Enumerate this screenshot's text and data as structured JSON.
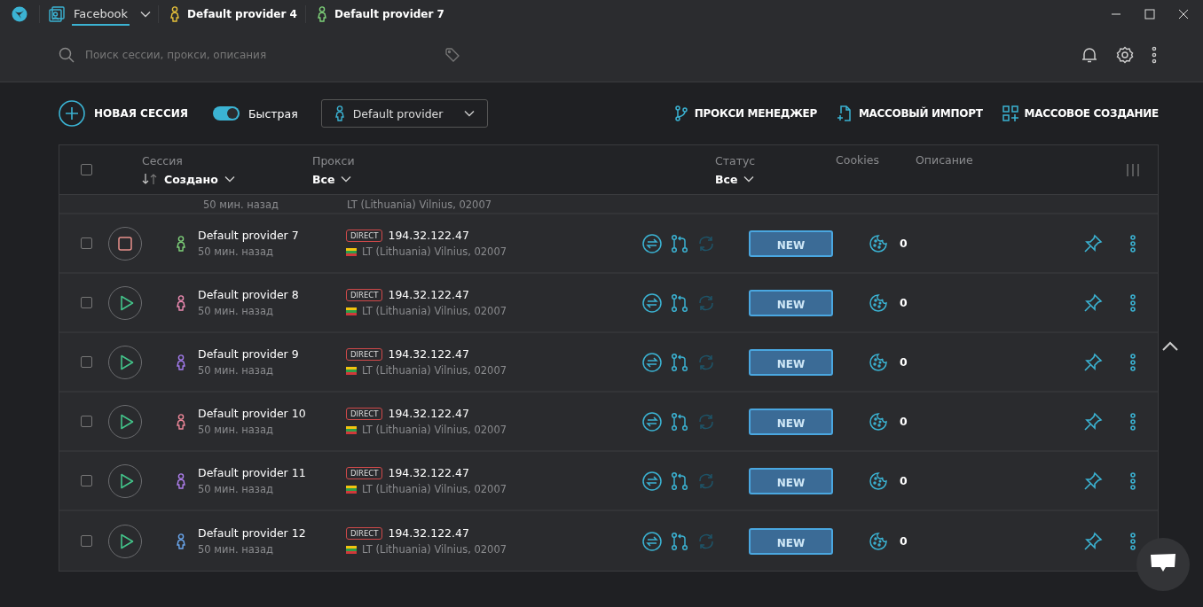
{
  "tabs": [
    {
      "label": "Facebook",
      "kind": "app",
      "selected": true
    },
    {
      "label": "Default provider 4",
      "kind": "profile",
      "color": "#e8c23a",
      "selected": false
    },
    {
      "label": "Default provider 7",
      "kind": "profile",
      "color": "#7fd37a",
      "selected": false
    }
  ],
  "search": {
    "placeholder": "Поиск сессии, прокси, описания"
  },
  "toolbar": {
    "new_session": "НОВАЯ СЕССИЯ",
    "quick": {
      "label": "Быстрая",
      "on": true
    },
    "provider": "Default provider",
    "actions": [
      "ПРОКСИ МЕНЕДЖЕР",
      "МАССОВЫЙ ИМПОРТ",
      "МАССОВОЕ СОЗДАНИЕ"
    ]
  },
  "table": {
    "select_all": {
      "checked": false
    },
    "columns": {
      "session": "Сессия",
      "sort": "Создано",
      "proxy": "Прокси",
      "proxy_filter": "Все",
      "status": "Статус",
      "status_filter": "Все",
      "cookies": "Cookies",
      "description": "Описание"
    },
    "partial_row": {
      "created": "50 мин. назад",
      "location": "LT (Lithuania) Vilnius, 02007"
    },
    "rows": [
      {
        "name": "Default provider 7",
        "created": "50 мин. назад",
        "color": "#7fd37a",
        "running": true,
        "checked": false,
        "proxy_type": "DIRECT",
        "ip": "194.32.122.47",
        "location": "LT (Lithuania) Vilnius, 02007",
        "status": "NEW",
        "cookies": "0"
      },
      {
        "name": "Default provider 8",
        "created": "50 мин. назад",
        "color": "#f08cb4",
        "running": false,
        "checked": false,
        "proxy_type": "DIRECT",
        "ip": "194.32.122.47",
        "location": "LT (Lithuania) Vilnius, 02007",
        "status": "NEW",
        "cookies": "0"
      },
      {
        "name": "Default provider 9",
        "created": "50 мин. назад",
        "color": "#a47cf0",
        "running": false,
        "checked": false,
        "proxy_type": "DIRECT",
        "ip": "194.32.122.47",
        "location": "LT (Lithuania) Vilnius, 02007",
        "status": "NEW",
        "cookies": "0"
      },
      {
        "name": "Default provider 10",
        "created": "50 мин. назад",
        "color": "#f0889a",
        "running": false,
        "checked": false,
        "proxy_type": "DIRECT",
        "ip": "194.32.122.47",
        "location": "LT (Lithuania) Vilnius, 02007",
        "status": "NEW",
        "cookies": "0"
      },
      {
        "name": "Default provider 11",
        "created": "50 мин. назад",
        "color": "#b07ff0",
        "running": false,
        "checked": false,
        "proxy_type": "DIRECT",
        "ip": "194.32.122.47",
        "location": "LT (Lithuania) Vilnius, 02007",
        "status": "NEW",
        "cookies": "0"
      },
      {
        "name": "Default provider 12",
        "created": "50 мин. назад",
        "color": "#6aa8f0",
        "running": false,
        "checked": false,
        "proxy_type": "DIRECT",
        "ip": "194.32.122.47",
        "location": "LT (Lithuania) Vilnius, 02007",
        "status": "NEW",
        "cookies": "0"
      }
    ]
  }
}
